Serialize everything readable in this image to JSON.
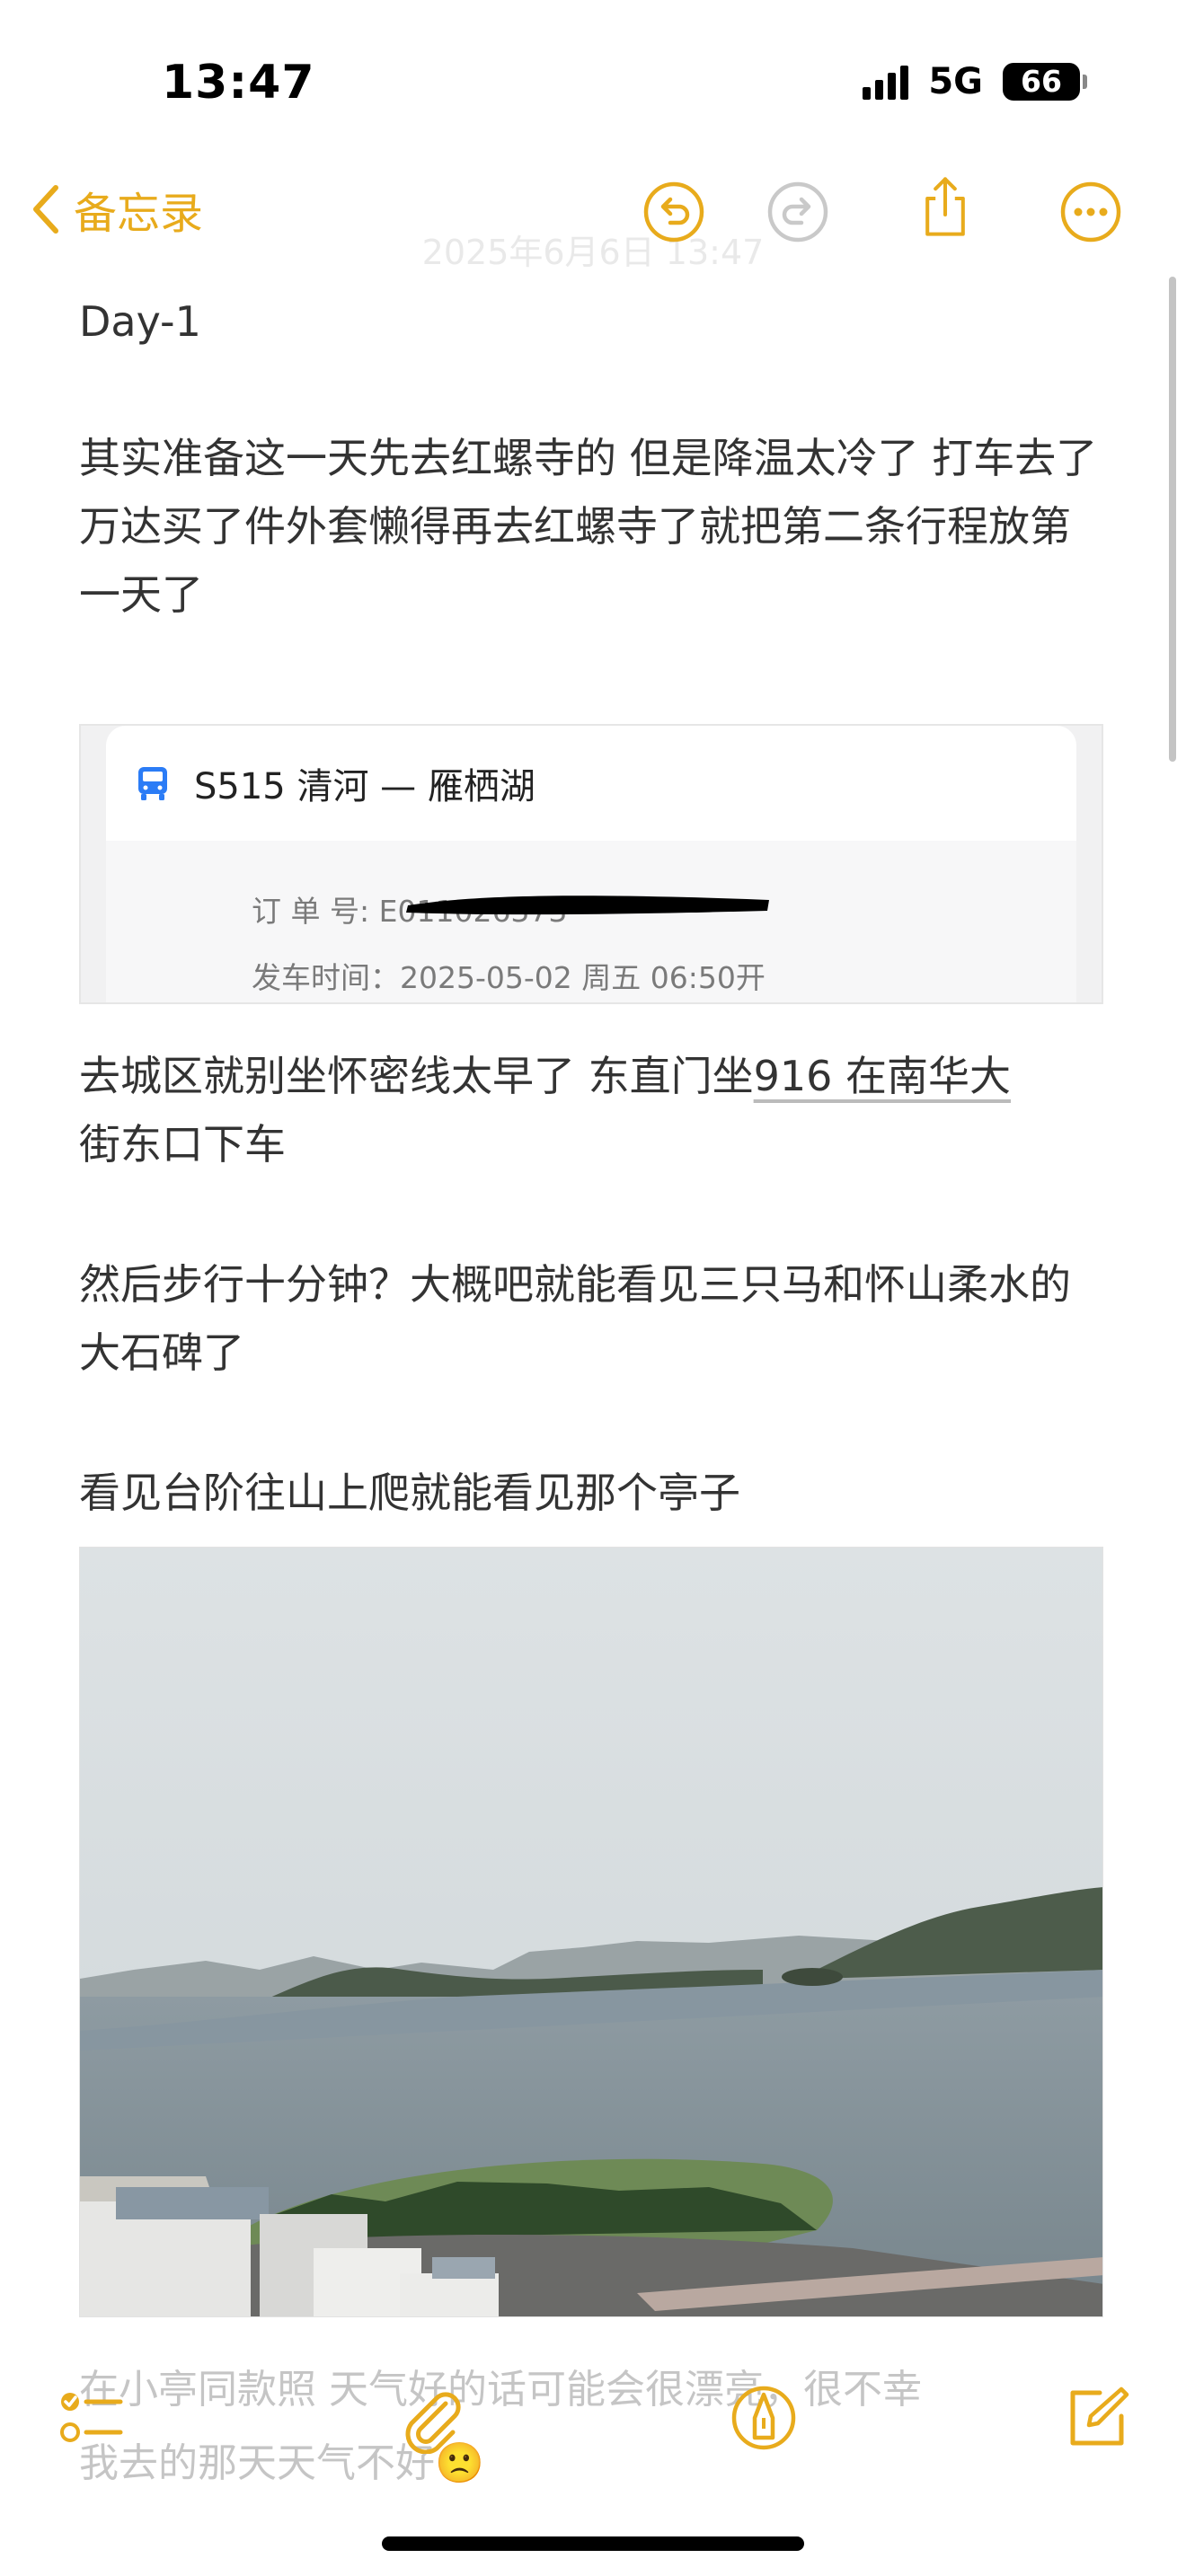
{
  "status_bar": {
    "time": "13:47",
    "network": "5G",
    "battery": "66"
  },
  "nav": {
    "back_label": "备忘录",
    "date_faded": "2025年6月6日 13:47"
  },
  "note": {
    "heading": "Day-1",
    "para1": "其实准备这一天先去红螺寺的 但是降温太冷了 打车去了万达买了件外套懒得再去红螺寺了就把第二条行程放第一天了",
    "ticket": {
      "route": "S515  清河 — 雁栖湖",
      "order_label": "订 单 号:",
      "order_partial": "E011026373",
      "depart_label": "发车时间：2025-05-02  周五  06:50开"
    },
    "para2_before": "去城区就别坐怀密线太早了 东直门坐",
    "para2_link": "916 在南华大",
    "para2_after": "街东口下车",
    "para3": "然后步行十分钟？大概吧就能看见三只马和怀山柔水的大石碑了",
    "para4": "看见台阶往山上爬就能看见那个亭子",
    "photo_alt": "雁栖湖 lake view",
    "faded_line1": "在小亭同款照 天气好的话可能会很漂亮，很不幸",
    "faded_line2": "我去的那天天气不好🙁"
  },
  "colors": {
    "accent": "#e8ab1c",
    "text": "#333333",
    "bus_blue": "#2b7cf6"
  },
  "icons": {
    "back": "chevron-left-icon",
    "undo": "undo-icon",
    "redo": "redo-icon",
    "share": "share-icon",
    "more": "more-icon",
    "checklist": "checklist-icon",
    "attach": "paperclip-icon",
    "markup": "pen-icon",
    "compose": "compose-icon",
    "bus": "bus-icon"
  }
}
